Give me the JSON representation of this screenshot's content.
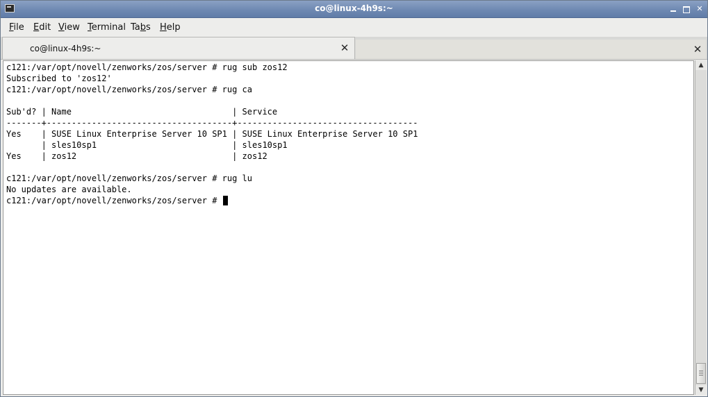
{
  "window": {
    "title": "co@linux-4h9s:~",
    "controls": {
      "minimize": "minimize",
      "maximize": "maximize",
      "close": "✕"
    }
  },
  "menu": {
    "file": {
      "mnemonic": "F",
      "rest": "ile"
    },
    "edit": {
      "mnemonic": "E",
      "rest": "dit"
    },
    "view": {
      "mnemonic": "V",
      "rest": "iew"
    },
    "terminal": {
      "mnemonic": "T",
      "rest": "erminal"
    },
    "tabs": {
      "pre": "Ta",
      "mnemonic": "b",
      "rest": "s"
    },
    "help": {
      "mnemonic": "H",
      "rest": "elp"
    }
  },
  "tabs": {
    "active": {
      "label": "co@linux-4h9s:~",
      "close": "✕"
    },
    "inactive_close": "✕"
  },
  "terminal": {
    "lines": [
      "c121:/var/opt/novell/zenworks/zos/server # rug sub zos12",
      "Subscribed to 'zos12'",
      "c121:/var/opt/novell/zenworks/zos/server # rug ca",
      "",
      "Sub'd? | Name                                | Service",
      "-------+-------------------------------------+------------------------------------",
      "Yes    | SUSE Linux Enterprise Server 10 SP1 | SUSE Linux Enterprise Server 10 SP1",
      "       | sles10sp1                           | sles10sp1",
      "Yes    | zos12                               | zos12",
      "",
      "c121:/var/opt/novell/zenworks/zos/server # rug lu",
      "No updates are available.",
      "c121:/var/opt/novell/zenworks/zos/server # "
    ]
  },
  "scrollbar": {
    "up": "▲",
    "down": "▼",
    "position_fraction": 1.0
  }
}
